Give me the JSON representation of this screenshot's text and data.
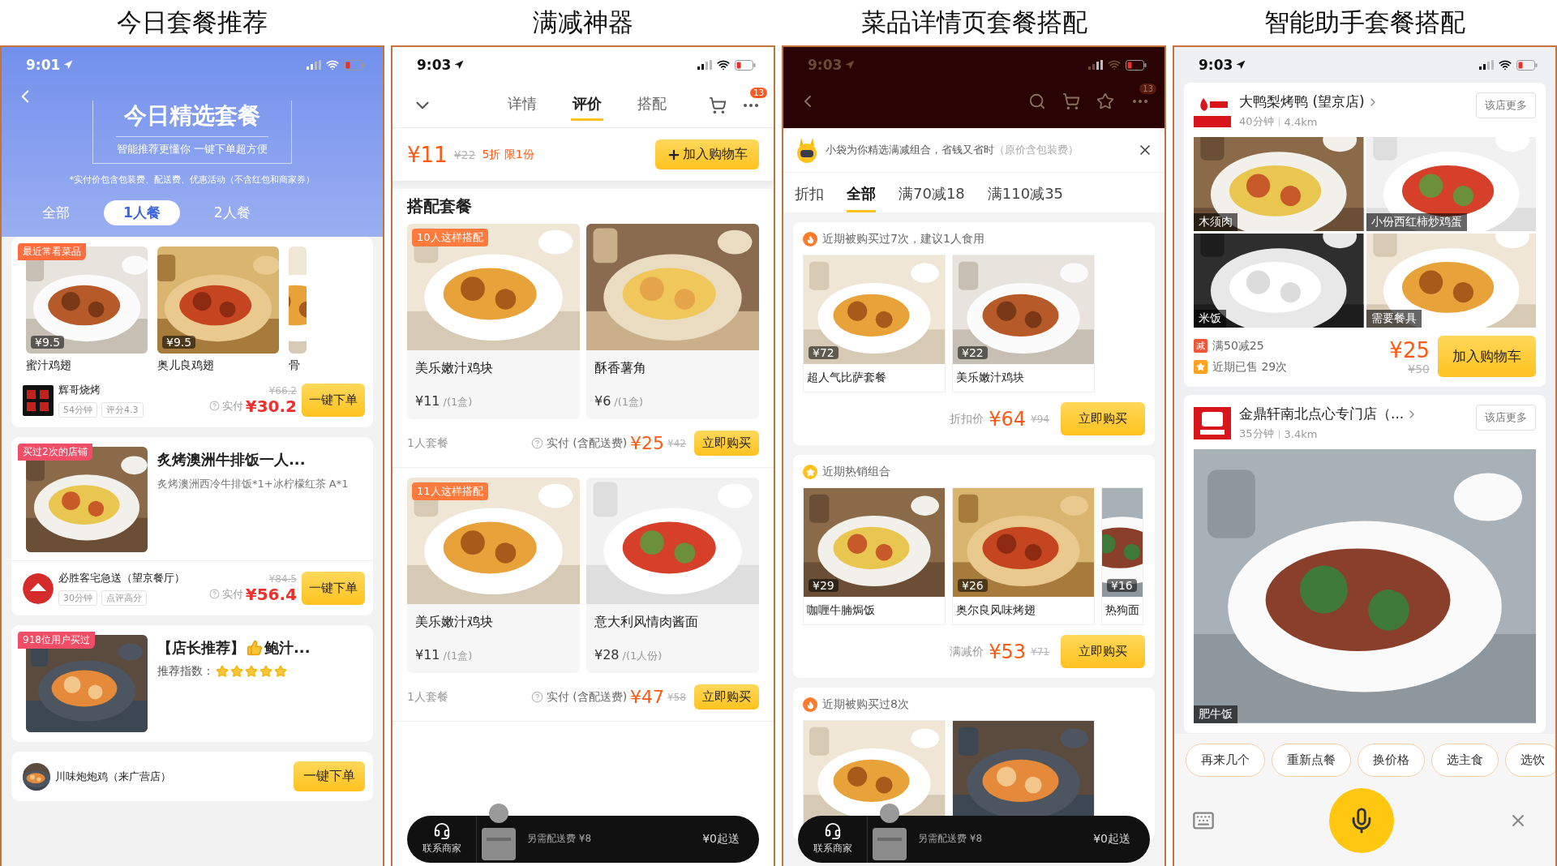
{
  "panels": [
    {
      "kind": "today",
      "caption": "今日套餐推荐",
      "time": "9:01",
      "title": "今日精选套餐",
      "subtitle": "智能推荐更懂你 一键下单超方便",
      "note": "*实付价包含包装费、配送费、优惠活动（不含红包和商家券）",
      "tabs": [
        {
          "label": "全部",
          "selected": false
        },
        {
          "label": "1人餐",
          "selected": true
        },
        {
          "label": "2人餐",
          "selected": false
        }
      ],
      "cards": [
        {
          "kind": "dishes",
          "badge": "最近常看菜品",
          "dishes": [
            {
              "price": "¥9.5",
              "name": "蜜汁鸡翅"
            },
            {
              "price": "¥9.5",
              "name": "奥儿良鸡翅"
            },
            {
              "name": "骨"
            }
          ],
          "shop": "辉哥烧烤",
          "tags": [
            "54分钟",
            "评分4.3"
          ],
          "old_price": "¥66.2",
          "paid_label": "实付",
          "price": "¥30.2",
          "button": "一键下单"
        },
        {
          "kind": "combo",
          "badge": "买过2次的店铺",
          "title": "炙烤澳洲牛排饭一人...",
          "description": "炙烤澳洲西冷牛排饭*1+冰柠檬红茶 A*1",
          "shop": "必胜客宅急送（望京餐厅）",
          "tags": [
            "30分钟",
            "点评高分"
          ],
          "old_price": "¥84.5",
          "paid_label": "实付",
          "price": "¥56.4",
          "button": "一键下单"
        },
        {
          "kind": "rating",
          "badge": "918位用户买过",
          "title_parts": [
            "【店长推荐】",
            "鲍汁..."
          ],
          "rating_label": "推荐指数：",
          "stars": 5
        }
      ],
      "next_shop": {
        "shop": "川味炮炮鸡（来广营店）",
        "button": "一键下单"
      }
    },
    {
      "kind": "bundle",
      "caption": "满减神器",
      "time": "9:03",
      "nav_tabs": [
        {
          "label": "详情",
          "selected": false
        },
        {
          "label": "评价",
          "selected": true
        },
        {
          "label": "搭配",
          "selected": false
        }
      ],
      "more_badge": "13",
      "price": "¥11",
      "old_price": "¥22",
      "promo": "5折 限1份",
      "add_button": "加入购物车",
      "section": "搭配套餐",
      "combos": [
        {
          "badge": "10人这样搭配",
          "items": [
            {
              "name": "美乐嫩汁鸡块",
              "price": "¥11",
              "unit": "/(1盒)"
            },
            {
              "name": "酥香薯角",
              "price": "¥6",
              "unit": "/(1盒)"
            }
          ],
          "label": "1人套餐",
          "paid_label": "实付 (含配送费)",
          "price": "¥25",
          "old_price": "¥42",
          "button": "立即购买"
        },
        {
          "badge": "11人这样搭配",
          "items": [
            {
              "name": "美乐嫩汁鸡块",
              "price": "¥11",
              "unit": "/(1盒)"
            },
            {
              "name": "意大利风情肉酱面",
              "price": "¥28",
              "unit": "/(1人份)"
            }
          ],
          "label": "1人套餐",
          "paid_label": "实付 (含配送费)",
          "price": "¥47",
          "old_price": "¥58",
          "button": "立即购买"
        }
      ],
      "bar": {
        "contact": "联系商家",
        "fee": "另需配送费 ¥8",
        "minimum": "¥0起送"
      }
    },
    {
      "kind": "suggest",
      "caption": "菜品详情页套餐搭配",
      "time": "9:03",
      "more_badge": "13",
      "intro": "小袋为你精选满减组合，省钱又省时",
      "intro_note": "（原价含包装费）",
      "tabs": [
        {
          "label": "折扣",
          "selected": false
        },
        {
          "label": "全部",
          "selected": true
        },
        {
          "label": "满70减18",
          "selected": false
        },
        {
          "label": "满110减35",
          "selected": false
        }
      ],
      "groups": [
        {
          "kind": "recent",
          "title": "近期被购买过7次，建议1人食用",
          "items": [
            {
              "kind": "dish",
              "price": "¥72",
              "name": "超人气比萨套餐"
            },
            {
              "kind": "dish",
              "price": "¥22",
              "name": "美乐嫩汁鸡块"
            }
          ],
          "price_label": "折扣价",
          "price": "¥64",
          "old_price": "¥94",
          "button": "立即购买"
        },
        {
          "kind": "popular",
          "title": "近期热销组合",
          "items": [
            {
              "kind": "dish",
              "price": "¥29",
              "name": "咖喱牛腩焗饭"
            },
            {
              "kind": "dish",
              "price": "¥26",
              "name": "奥尔良风味烤翅"
            },
            {
              "kind": "dish",
              "price": "¥16",
              "name": "热狗面"
            }
          ],
          "price_label": "满减价",
          "price": "¥53",
          "old_price": "¥71",
          "button": "立即购买"
        },
        {
          "kind": "recent",
          "title": "近期被购买过8次"
        }
      ],
      "bar": {
        "contact": "联系商家",
        "fee": "另需配送费 ¥8",
        "minimum": "¥0起送"
      }
    },
    {
      "kind": "assistant",
      "caption": "智能助手套餐搭配",
      "time": "9:03",
      "stores": [
        {
          "name": "大鸭梨烤鸭 (望京店)",
          "meta": [
            "40分钟",
            "4.4km"
          ],
          "more": "该店更多",
          "dishes": [
            "木须肉",
            "小份西红柿炒鸡蛋",
            "米饭",
            "需要餐具"
          ],
          "promos": [
            {
              "kind": "discount",
              "badge": "减",
              "text": "满50减25"
            },
            {
              "kind": "sales",
              "text": "近期已售 29次"
            }
          ],
          "price": "¥25",
          "old_price": "¥50",
          "button": "加入购物车"
        },
        {
          "name": "金鼎轩南北点心专门店（...",
          "meta": [
            "35分钟",
            "3.4km"
          ],
          "more": "该店更多",
          "dishes": [
            "肥牛饭"
          ]
        }
      ],
      "chips": [
        "再来几个",
        "重新点餐",
        "换价格",
        "选主食",
        "选饮"
      ]
    }
  ]
}
